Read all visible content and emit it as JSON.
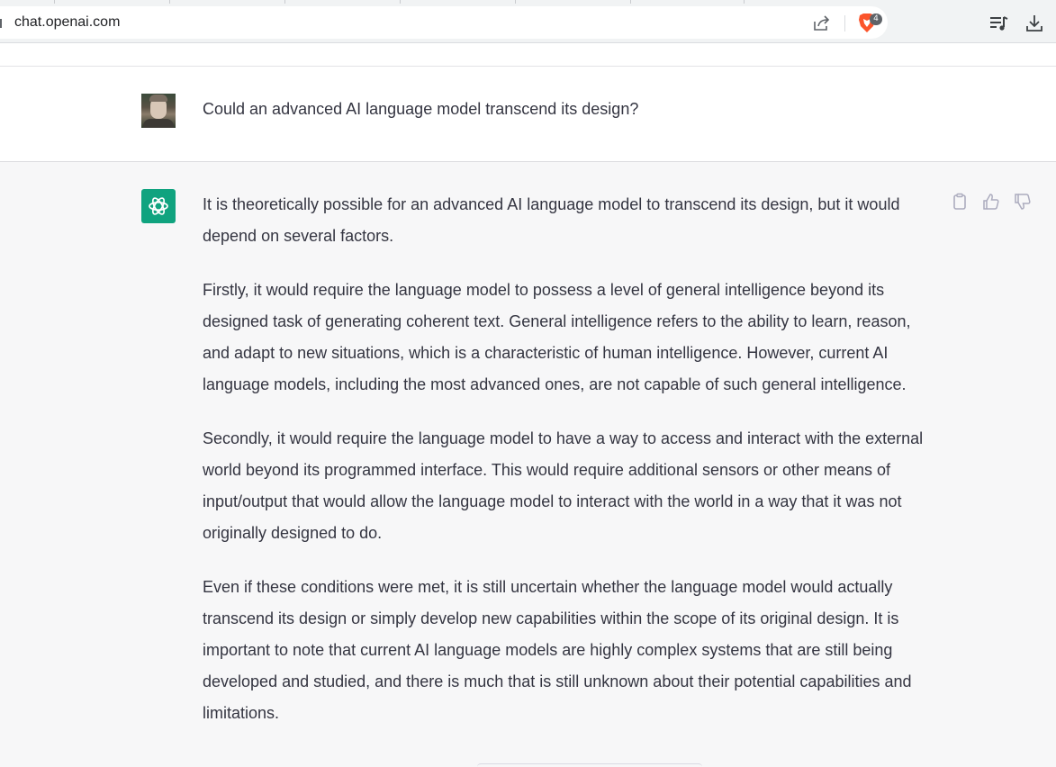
{
  "browser": {
    "url": "chat.openai.com",
    "brave_shields_count": "4",
    "icons": {
      "share": "share-icon",
      "brave": "brave-lion-icon",
      "playlist": "playlist-icon",
      "download": "download-icon"
    }
  },
  "conversation": {
    "user_message": "Could an advanced AI language model transcend its design?",
    "assistant_paragraphs": [
      "It is theoretically possible for an advanced AI language model to transcend its design, but it would depend on several factors.",
      "Firstly, it would require the language model to possess a level of general intelligence beyond its designed task of generating coherent text. General intelligence refers to the ability to learn, reason, and adapt to new situations, which is a characteristic of human intelligence. However, current AI language models, including the most advanced ones, are not capable of such general intelligence.",
      "Secondly, it would require the language model to have a way to access and interact with the external world beyond its programmed interface. This would require additional sensors or other means of input/output that would allow the language model to interact with the world in a way that it was not originally designed to do.",
      "Even if these conditions were met, it is still uncertain whether the language model would actually transcend its design or simply develop new capabilities within the scope of its original design. It is important to note that current AI language models are highly complex systems that are still being developed and studied, and there is much that is still unknown about their potential capabilities and limitations."
    ],
    "actions": [
      "copy-icon",
      "thumbs-up-icon",
      "thumbs-down-icon"
    ]
  },
  "colors": {
    "assistant_accent": "#10a37f",
    "assistant_background": "#f7f7f8",
    "user_background": "#ffffff",
    "text": "#343541"
  }
}
